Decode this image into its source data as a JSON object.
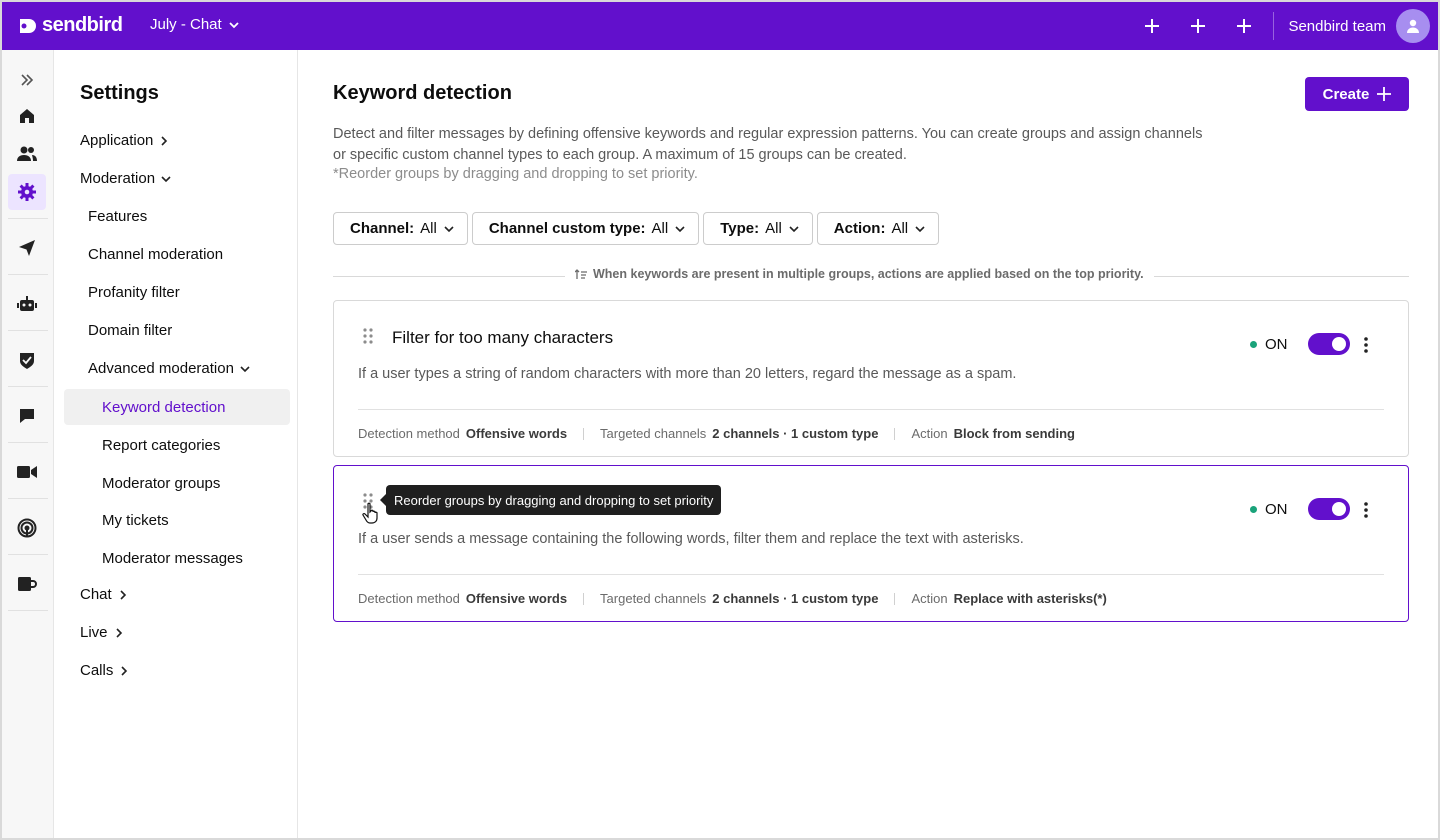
{
  "colors": {
    "brand": "#6210cc",
    "status_on": "#1aa37a"
  },
  "topbar": {
    "logo_text": "sendbird",
    "app_name": "July - Chat",
    "team_name": "Sendbird team",
    "icons": [
      "plus-icon",
      "plus-icon",
      "plus-icon",
      "user-avatar-icon"
    ]
  },
  "rail": {
    "icons": [
      "expand-icon",
      "home-icon",
      "users-icon",
      "gear-icon",
      "send-icon",
      "bot-icon",
      "shield-check-icon",
      "chat-icon",
      "video-icon",
      "live-icon",
      "desk-icon"
    ],
    "active": "gear-icon"
  },
  "sidenav": {
    "title": "Settings",
    "application": "Application",
    "moderation": "Moderation",
    "features": "Features",
    "channel_moderation": "Channel moderation",
    "profanity_filter": "Profanity filter",
    "domain_filter": "Domain filter",
    "advanced_moderation": "Advanced moderation",
    "keyword_detection": "Keyword detection",
    "report_categories": "Report categories",
    "moderator_groups": "Moderator groups",
    "my_tickets": "My tickets",
    "moderator_messages": "Moderator messages",
    "chat": "Chat",
    "live": "Live",
    "calls": "Calls"
  },
  "main": {
    "title": "Keyword detection",
    "create_label": "Create",
    "description": "Detect and filter messages by defining offensive keywords and regular expression patterns. You can create groups and assign channels or specific custom channel types to each group. A maximum of 15 groups can be created.",
    "note": "*Reorder groups by dragging and dropping to set priority.",
    "filters": [
      {
        "label": "Channel:",
        "value": "All"
      },
      {
        "label": "Channel custom type:",
        "value": "All"
      },
      {
        "label": "Type:",
        "value": "All"
      },
      {
        "label": "Action:",
        "value": "All"
      }
    ],
    "priority_note": "When keywords are present in multiple groups, actions are applied based on the top priority."
  },
  "groups": [
    {
      "title": "Filter for too many characters",
      "description": "If a user types a string of random characters with more than 20 letters, regard the message as a spam.",
      "status": "ON",
      "detection_label": "Detection method",
      "detection_value": "Offensive words",
      "channels_label": "Targeted channels",
      "channels_value": "2 channels · 1 custom type",
      "action_label": "Action",
      "action_value": "Block from sending"
    },
    {
      "title": "",
      "description": "If a user sends a message containing the following words, filter them and replace the text with asterisks.",
      "status": "ON",
      "detection_label": "Detection method",
      "detection_value": "Offensive words",
      "channels_label": "Targeted channels",
      "channels_value": "2 channels · 1 custom type",
      "action_label": "Action",
      "action_value": "Replace with asterisks(*)",
      "tooltip": "Reorder groups by dragging and dropping to set priority"
    }
  ]
}
